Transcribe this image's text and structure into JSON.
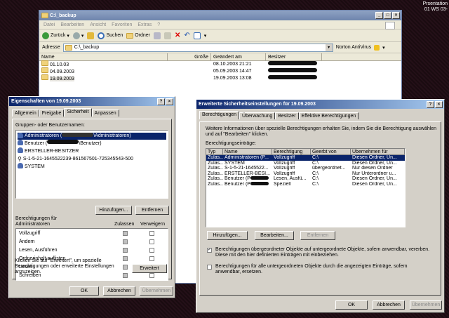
{
  "desktop": {
    "corner_line1": "Prsentation",
    "corner_line2": "01  WS 03-"
  },
  "explorer": {
    "title": "C:\\_backup",
    "menu": [
      "Datei",
      "Bearbeiten",
      "Ansicht",
      "Favoriten",
      "Extras",
      "?"
    ],
    "toolbar": {
      "back": "Zurück",
      "search": "Suchen",
      "folders": "Ordner"
    },
    "address_label": "Adresse",
    "address_value": "C:\\_backup",
    "antivirus": "Norton AntiVirus",
    "columns": [
      "Name",
      "Größe",
      "Geändert am",
      "Besitzer"
    ],
    "rows": [
      {
        "name": "01.10.03",
        "date": "08.10.2003 21:21"
      },
      {
        "name": "04.09.2003",
        "date": "05.09.2003 14:47"
      },
      {
        "name": "19.09.2003",
        "date": "19.09.2003 13:08"
      }
    ]
  },
  "props": {
    "title": "Eigenschaften von 19.09.2003",
    "tabs": [
      "Allgemein",
      "Freigabe",
      "Sicherheit",
      "Anpassen"
    ],
    "groups_label": "Gruppen- oder Benutzernamen:",
    "users": [
      {
        "pre": "Administratoren (",
        "post": "\\Administratoren)"
      },
      {
        "pre": "Benutzer (",
        "post": "\\Benutzer)"
      },
      {
        "pre": "ERSTELLER-BESITZER",
        "post": ""
      },
      {
        "pre": "S-1-5-21-1645522239-861567501-725345543-500",
        "post": ""
      },
      {
        "pre": "SYSTEM",
        "post": ""
      }
    ],
    "add_btn": "Hinzufügen...",
    "remove_btn": "Entfernen",
    "perm_label_1": "Berechtigungen für",
    "perm_label_2": "Administratoren",
    "allow": "Zulassen",
    "deny": "Verweigern",
    "perms": [
      "Vollzugriff",
      "Ändern",
      "Lesen, Ausführen",
      "Ordnerinhalt auflisten",
      "Lesen",
      "Schreiben"
    ],
    "advanced_text": "Klicken Sie auf \"Erweitert\", um spezielle Berechtigungen oder erweiterte Einstellungen anzuzeigen.",
    "advanced_btn": "Erweitert",
    "ok": "OK",
    "cancel": "Abbrechen",
    "apply": "Übernehmen"
  },
  "adv": {
    "title": "Erweiterte Sicherheitseinstellungen für 19.09.2003",
    "tabs": [
      "Berechtigungen",
      "Überwachung",
      "Besitzer",
      "Effektive Berechtigungen"
    ],
    "info": "Weitere Informationen über spezielle Berechtigungen erhalten Sie, indem Sie die Berechtigung auswählen und auf \"Bearbeiten\" klicken.",
    "entries_label": "Berechtigungseinträge:",
    "columns": [
      "Typ",
      "Name",
      "Berechtigung",
      "Geerbt von",
      "Übernehmen für"
    ],
    "rows": [
      {
        "typ": "Zulas...",
        "name": "Administratoren (P...",
        "perm": "Vollzugriff",
        "from": "C:\\",
        "apply": "Diesen Ordner, Un..."
      },
      {
        "typ": "Zulas...",
        "name": "SYSTEM",
        "perm": "Vollzugriff",
        "from": "C:\\",
        "apply": "Diesen Ordner, Un..."
      },
      {
        "typ": "Zulas...",
        "name": "S-1-5-21-1645522...",
        "perm": "Vollzugriff",
        "from": "übergeordnet...",
        "apply": "Nur diesen Ordner"
      },
      {
        "typ": "Zulas...",
        "name": "ERSTELLER-BESI...",
        "perm": "Vollzugriff",
        "from": "C:\\",
        "apply": "Nur Unterordner u..."
      },
      {
        "typ": "Zulas...",
        "name": "Benutzer (P",
        "perm": "Lesen, Ausfü...",
        "from": "C:\\",
        "apply": "Diesen Ordner, Un..."
      },
      {
        "typ": "Zulas...",
        "name": "Benutzer (P",
        "perm": "Speziell",
        "from": "C:\\",
        "apply": "Diesen Ordner, Un..."
      }
    ],
    "add_btn": "Hinzufügen...",
    "edit_btn": "Bearbeiten...",
    "remove_btn": "Entfernen",
    "inherit_text": "Berechtigungen übergeordneter Objekte auf untergeordnete Objekte, sofern anwendbar, vererben. Diese mit den hier definierten Einträgen mit einbeziehen.",
    "replace_text": "Berechtigungen für alle untergeordneten Objekte durch die angezeigten Einträge, sofern anwendbar, ersetzen.",
    "ok": "OK",
    "cancel": "Abbrechen",
    "apply": "Übernehmen"
  }
}
